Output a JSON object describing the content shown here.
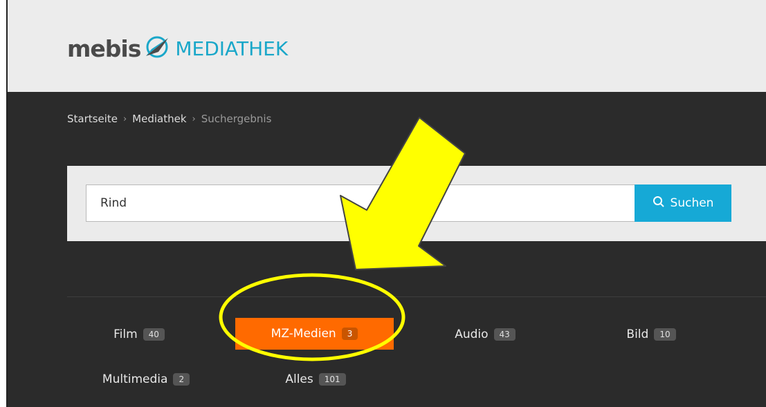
{
  "header": {
    "logo_brand": "mebis",
    "logo_product": "MEDIATHEK"
  },
  "breadcrumb": {
    "items": [
      "Startseite",
      "Mediathek",
      "Suchergebnis"
    ],
    "separator": "›"
  },
  "search": {
    "value": "Rind",
    "button_label": "Suchen"
  },
  "tabs": [
    {
      "label": "Film",
      "count": "40",
      "active": false
    },
    {
      "label": "MZ-Medien",
      "count": "3",
      "active": true
    },
    {
      "label": "Audio",
      "count": "43",
      "active": false
    },
    {
      "label": "Bild",
      "count": "10",
      "active": false
    },
    {
      "label": "Multimedia",
      "count": "2",
      "active": false
    },
    {
      "label": "Alles",
      "count": "101",
      "active": false
    }
  ],
  "colors": {
    "accent": "#16a9d6",
    "active_tab": "#ff6a00",
    "annotation_arrow": "#ffff00",
    "annotation_ring": "#ffff00"
  },
  "annotations": {
    "arrow_icon": "down-left-arrow-icon",
    "highlight": "ellipse-highlight"
  }
}
